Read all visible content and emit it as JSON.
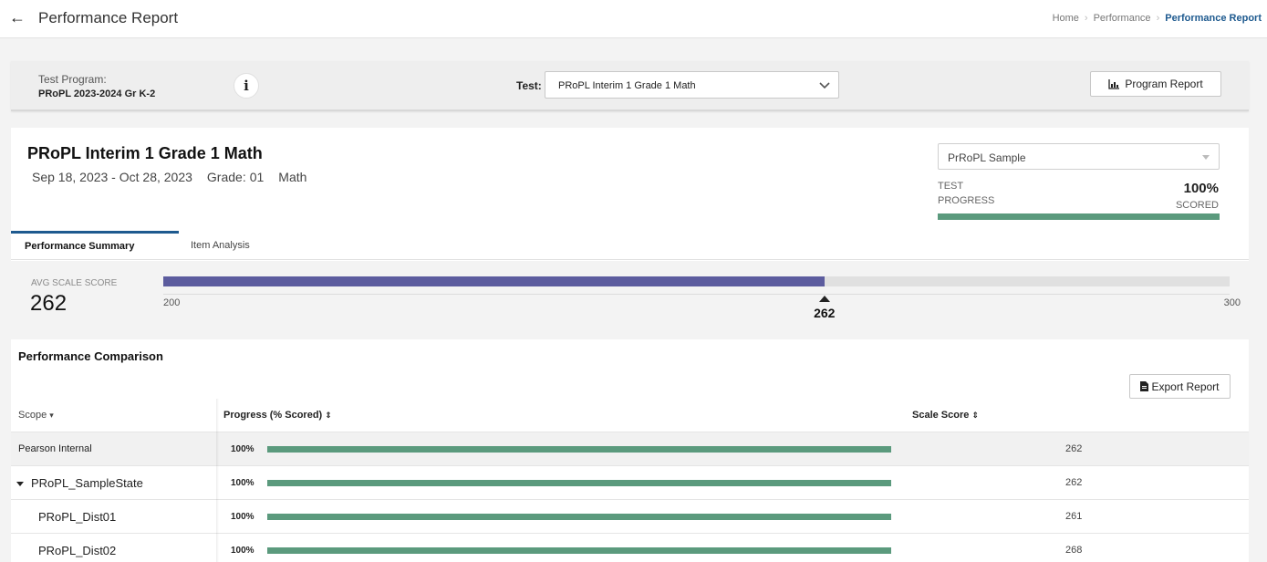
{
  "header": {
    "back_icon": "arrow-left-icon",
    "title": "Performance Report",
    "breadcrumb": [
      "Home",
      "Performance",
      "Performance Report"
    ]
  },
  "filters": {
    "test_program_label": "Test Program:",
    "test_program_value": "PRoPL 2023-2024 Gr K-2",
    "test_label": "Test:",
    "test_value": "PRoPL Interim 1 Grade 1 Math",
    "program_report_label": "Program Report"
  },
  "report": {
    "title": "PRoPL Interim 1 Grade 1 Math",
    "date_range": "Sep 18, 2023 - Oct 28, 2023",
    "grade_label": "Grade:",
    "grade_value": "01",
    "subject": "Math",
    "sample_select": "PrRoPL Sample",
    "test_progress_label": "TEST PROGRESS",
    "test_progress_value": "100%",
    "test_progress_fraction": 1.0,
    "scored_label": "SCORED"
  },
  "tabs": {
    "performance_summary": "Performance Summary",
    "item_analysis": "Item Analysis"
  },
  "avg_score": {
    "label": "AVG SCALE SCORE",
    "value": "262",
    "min": 200,
    "max": 300,
    "score": 262,
    "min_label": "200",
    "max_label": "300",
    "marker_label": "262"
  },
  "comparison": {
    "title": "Performance Comparison",
    "export_label": "Export Report",
    "columns": {
      "scope": "Scope",
      "progress": "Progress (% Scored)",
      "score": "Scale Score"
    },
    "rows": [
      {
        "scope": "Pearson Internal",
        "pct": "100%",
        "fraction": 1.0,
        "score": "262"
      },
      {
        "scope": "PRoPL_SampleState",
        "pct": "100%",
        "fraction": 1.0,
        "score": "262"
      },
      {
        "scope": "PRoPL_Dist01",
        "pct": "100%",
        "fraction": 1.0,
        "score": "261"
      },
      {
        "scope": "PRoPL_Dist02",
        "pct": "100%",
        "fraction": 1.0,
        "score": "268"
      }
    ]
  },
  "colors": {
    "accent": "#1e5a8f",
    "score_bar": "#5c5c9e",
    "progress_bar": "#5b9a7d"
  }
}
